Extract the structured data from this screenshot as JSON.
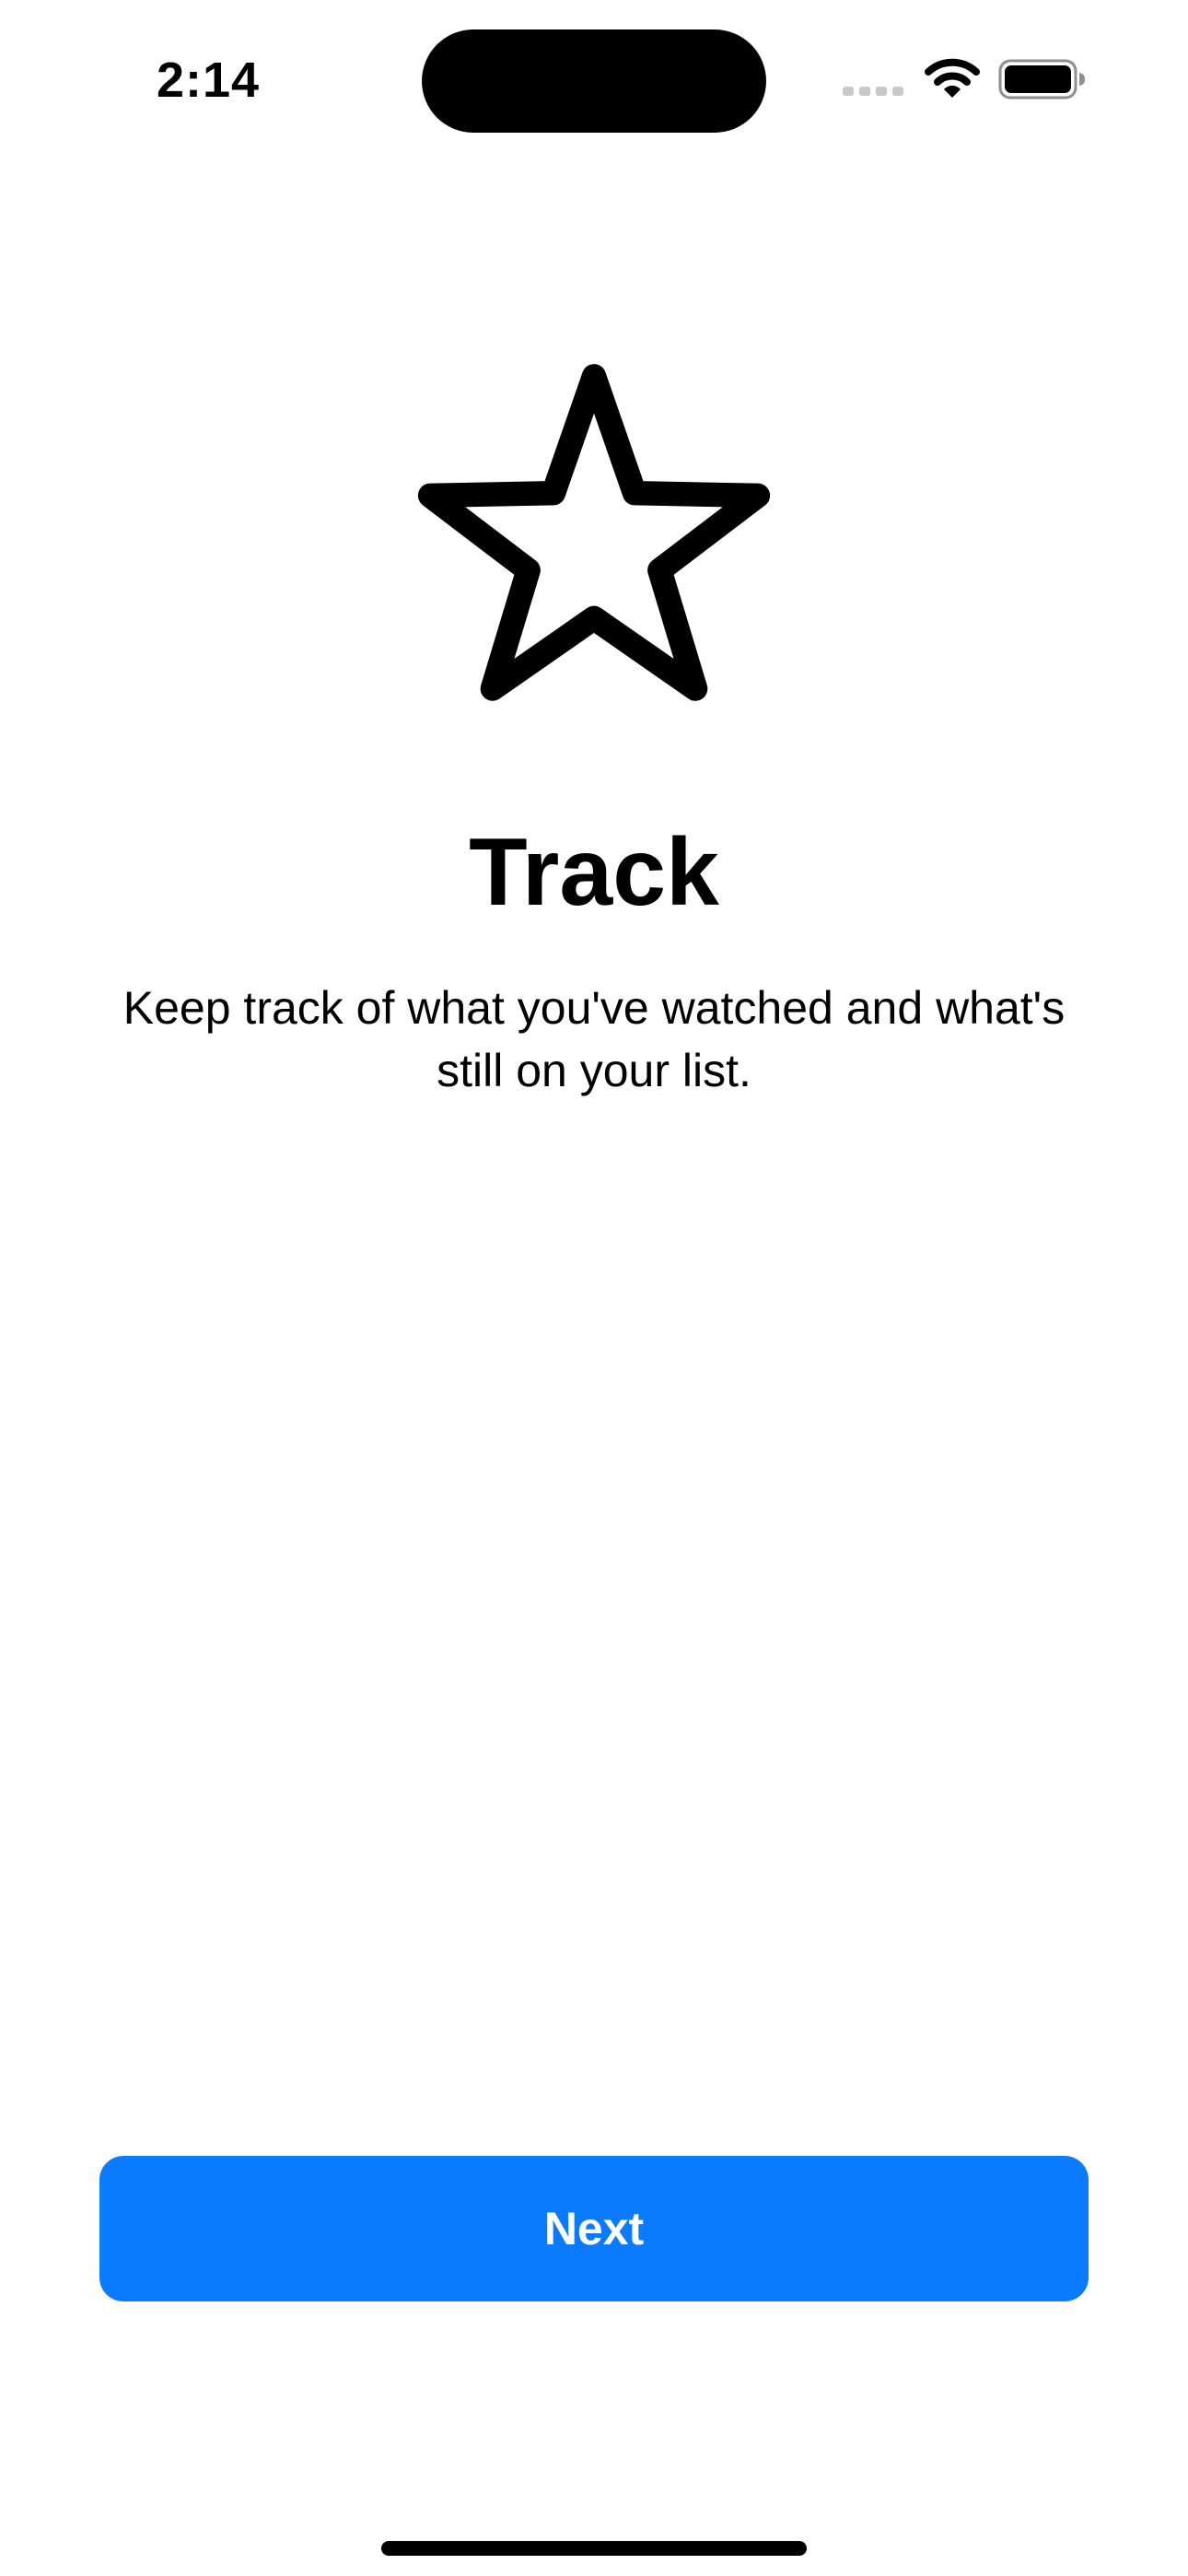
{
  "status_bar": {
    "time": "2:14",
    "icons": [
      "cellular-icon",
      "wifi-icon",
      "battery-icon"
    ]
  },
  "onboarding": {
    "icon": "star-icon",
    "title": "Track",
    "description": "Keep track of what you've watched and what's still on your list."
  },
  "actions": {
    "next_label": "Next"
  },
  "colors": {
    "accent": "#0a7aff",
    "background": "#ffffff",
    "text": "#000000"
  }
}
